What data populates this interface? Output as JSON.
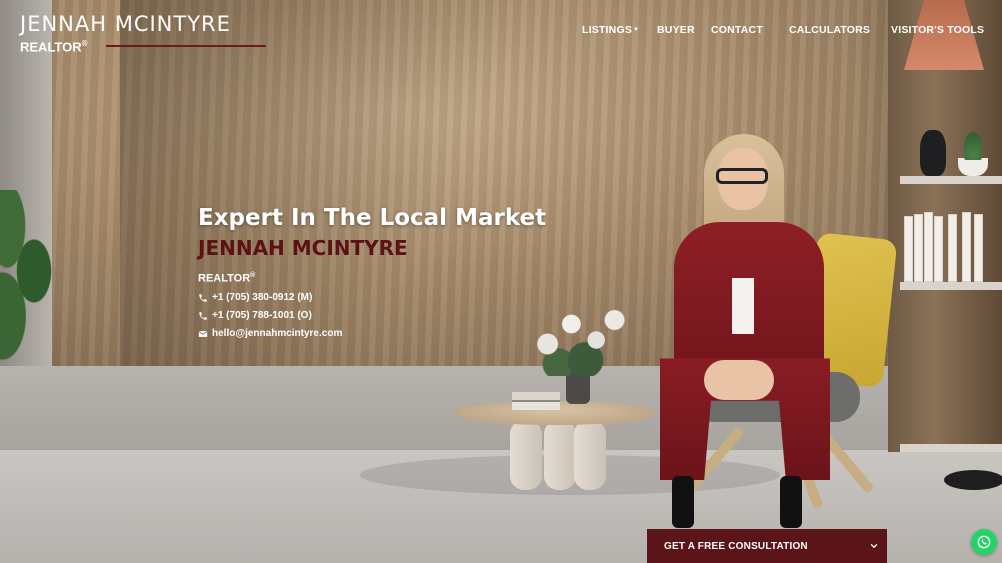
{
  "brand": {
    "name": "JENNAH MCINTYRE",
    "title": "REALTOR",
    "title_mark": "®"
  },
  "nav": {
    "items": [
      {
        "label": "LISTINGS",
        "has_dropdown": true
      },
      {
        "label": "BUYER",
        "has_dropdown": false
      },
      {
        "label": "CONTACT",
        "has_dropdown": false
      },
      {
        "label": "CALCULATORS",
        "has_dropdown": false
      },
      {
        "label": "VISITOR'S TOOLS",
        "has_dropdown": false
      }
    ]
  },
  "hero": {
    "tagline": "Expert In The Local Market",
    "name": "JENNAH MCINTYRE",
    "title": "REALTOR",
    "title_mark": "®",
    "contacts": [
      {
        "icon": "phone-icon",
        "text": "+1 (705) 380-0912 (M)"
      },
      {
        "icon": "phone-icon",
        "text": "+1 (705) 788-1001 (O)"
      },
      {
        "icon": "envelope-icon",
        "text": "hello@jennahmcintyre.com"
      }
    ]
  },
  "cta": {
    "label": "GET A FREE CONSULTATION",
    "icon": "chevron-down-icon"
  },
  "floating": {
    "icon": "whatsapp-icon"
  },
  "colors": {
    "accent": "#5b1418",
    "name_text": "#5a1217",
    "whatsapp": "#25d366",
    "nav_text": "#ffffff"
  }
}
